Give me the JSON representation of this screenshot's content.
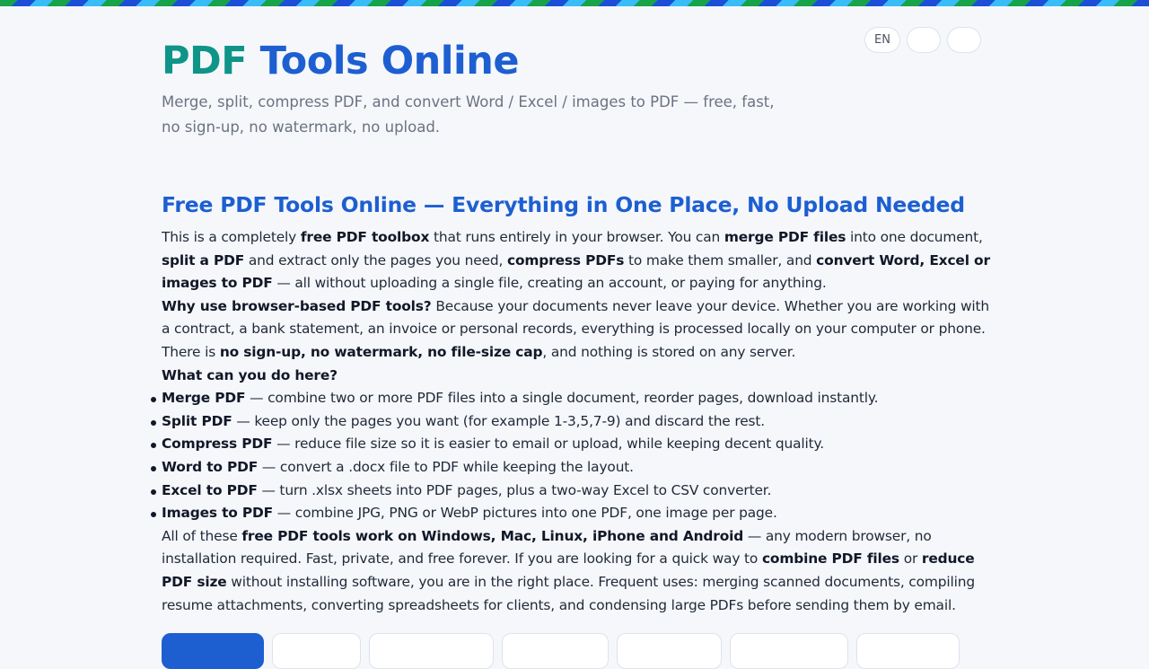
{
  "header": {
    "title_accent": "PDF",
    "title_rest": " Tools Online",
    "tagline": "Merge, split, compress PDF, and convert Word / Excel / images to PDF — free, fast, no sign-up, no watermark, no upload.",
    "languages": [
      "EN",
      "",
      ""
    ]
  },
  "intro": {
    "heading": "Free PDF Tools Online — Everything in One Place, No Upload Needed",
    "p1": {
      "t1": "This is a completely ",
      "b1": "free PDF toolbox",
      "t2": " that runs entirely in your browser. You can ",
      "b2": "merge PDF files",
      "t3": " into one document, ",
      "b3": "split a PDF",
      "t4": " and extract only the pages you need, ",
      "b4": "compress PDFs",
      "t5": " to make them smaller, and ",
      "b5": "convert Word, Excel or images to PDF",
      "t6": " — all without uploading a single file, creating an account, or paying for anything."
    },
    "p2": {
      "b1": "Why use browser-based PDF tools?",
      "t1": " Because your documents never leave your device. Whether you are working with a contract, a bank statement, an invoice or personal records, everything is processed locally on your computer or phone. There is ",
      "b2": "no sign-up, no watermark, no file-size cap",
      "t2": ", and nothing is stored on any server."
    },
    "features_heading": "What can you do here?",
    "features": [
      {
        "name": "Merge PDF",
        "desc": " — combine two or more PDF files into a single document, reorder pages, download instantly."
      },
      {
        "name": "Split PDF",
        "desc": " — keep only the pages you want (for example 1-3,5,7-9) and discard the rest."
      },
      {
        "name": "Compress PDF",
        "desc": " — reduce file size so it is easier to email or upload, while keeping decent quality."
      },
      {
        "name": "Word to PDF",
        "desc": " — convert a .docx file to PDF while keeping the layout."
      },
      {
        "name": "Excel to PDF",
        "desc": " — turn .xlsx sheets into PDF pages, plus a two-way Excel to CSV converter."
      },
      {
        "name": "Images to PDF",
        "desc": " — combine JPG, PNG or WebP pictures into one PDF, one image per page."
      }
    ],
    "p3": {
      "t1": "All of these ",
      "b1": "free PDF tools work on Windows, Mac, Linux, iPhone and Android",
      "t2": " — any modern browser, no installation required. Fast, private, and free forever. If you are looking for a quick way to ",
      "b2": "combine PDF files",
      "t3": " or ",
      "b3": "reduce PDF size",
      "t4": " without installing software, you are in the right place. Frequent uses: merging scanned documents, compiling resume attachments, converting spreadsheets for clients, and condensing large PDFs before sending them by email."
    }
  },
  "colors": {
    "brand_blue": "#1d5fd1",
    "brand_teal": "#0f9488",
    "page_background": "#f5f7fb"
  }
}
